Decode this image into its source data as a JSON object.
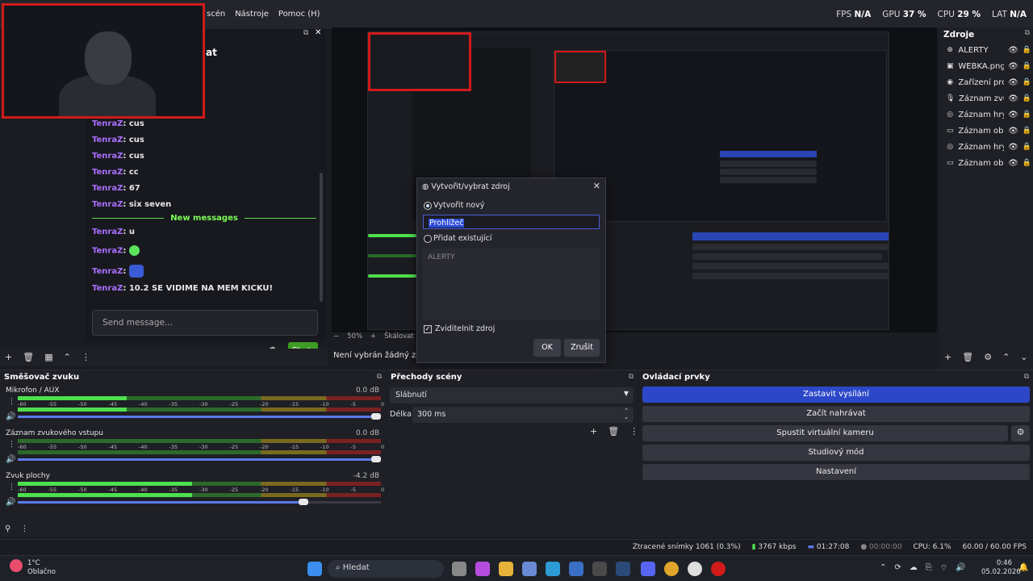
{
  "menubar": {
    "items": [
      "scén",
      "Nástroje",
      "Pomoc (H)"
    ]
  },
  "stats": {
    "fps_label": "FPS",
    "fps": "N/A",
    "gpu_label": "GPU",
    "gpu": "37 %",
    "cpu_label": "CPU",
    "cpu": "29 %",
    "lat_label": "LAT",
    "lat": "N/A"
  },
  "chat": {
    "title": "at",
    "lines_before": [
      {
        "user": "TenraZ",
        "text": "cus"
      },
      {
        "user": "TenraZ",
        "text": "cus"
      },
      {
        "user": "TenraZ",
        "text": "cus"
      },
      {
        "user": "TenraZ",
        "text": "cc"
      },
      {
        "user": "TenraZ",
        "text": "67"
      },
      {
        "user": "TenraZ",
        "text": "six seven"
      }
    ],
    "new_messages": "New messages",
    "lines_after": [
      {
        "user": "TenraZ",
        "text": "u"
      },
      {
        "user": "TenraZ",
        "text": ""
      },
      {
        "user": "TenraZ",
        "text": ""
      },
      {
        "user": "TenraZ",
        "text": "10.2 SE VIDIME NA MEM KICKU!"
      }
    ],
    "send_placeholder": "Send message...",
    "chat_button": "Chat"
  },
  "scene_toolbar": {
    "zoom": "50%",
    "scale_label": "Škálovat na",
    "no_source": "Není vybrán žádný zdroj"
  },
  "dialog": {
    "title": "Vytvořit/vybrat zdroj",
    "create_new": "Vytvořit nový",
    "name_value": "Prohlížeč",
    "add_existing": "Přidat existující",
    "existing_items": [
      "ALERTY"
    ],
    "visible_label": "Zviditelnit zdroj",
    "ok": "OK",
    "cancel": "Zrušit"
  },
  "sources": {
    "title": "Zdroje",
    "items": [
      {
        "icon": "globe-icon",
        "name": "ALERTY"
      },
      {
        "icon": "image-icon",
        "name": "WEBKA.png"
      },
      {
        "icon": "camera-icon",
        "name": "Zařízení pro z"
      },
      {
        "icon": "mic-icon",
        "name": "Záznam zvuko"
      },
      {
        "icon": "gamepad-icon",
        "name": "Záznam hry"
      },
      {
        "icon": "monitor-icon",
        "name": "Záznam obra"
      },
      {
        "icon": "gamepad-icon",
        "name": "Záznam hry"
      },
      {
        "icon": "monitor-icon",
        "name": "Záznam obra"
      }
    ]
  },
  "mixer": {
    "title": "Směšovač zvuku",
    "ticks": [
      "-60",
      "-55",
      "-50",
      "-45",
      "-40",
      "-35",
      "-30",
      "-25",
      "-20",
      "-15",
      "-10",
      "-5",
      "0"
    ],
    "channels": [
      {
        "name": "Mikrofon / AUX",
        "db": "0.0 dB",
        "level": 0.3,
        "volume": 1.0
      },
      {
        "name": "Záznam zvukového vstupu",
        "db": "0.0 dB",
        "level": 0.0,
        "volume": 1.0
      },
      {
        "name": "Zvuk plochy",
        "db": "-4.2 dB",
        "level": 0.48,
        "volume": 0.8
      }
    ]
  },
  "transitions": {
    "title": "Přechody scény",
    "selected": "Slábnutí",
    "duration_label": "Délka",
    "duration": "300 ms"
  },
  "controls": {
    "title": "Ovládací prvky",
    "buttons": [
      "Zastavit vysílání",
      "Začít nahrávat",
      "Spustit virtuální kameru",
      "Studiový mód",
      "Nastavení"
    ]
  },
  "statusbar": {
    "dropped": "Ztracené snímky 1061 (0.3%)",
    "kbps": "3767 kbps",
    "stream_time": "01:27:08",
    "rec_time": "00:00:00",
    "cpu": "CPU: 6.1%",
    "fps": "60.00 / 60.00 FPS"
  },
  "taskbar": {
    "temp": "1°C",
    "weather": "Oblačno",
    "search": "Hledat",
    "time": "0:46",
    "date": "05.02.2026"
  },
  "colors": {
    "accent": "#2c48c9",
    "live_border": "#d11a1a",
    "chat_button": "#3f9b24",
    "username": "#a970ff",
    "new_messages": "#7aff57"
  }
}
